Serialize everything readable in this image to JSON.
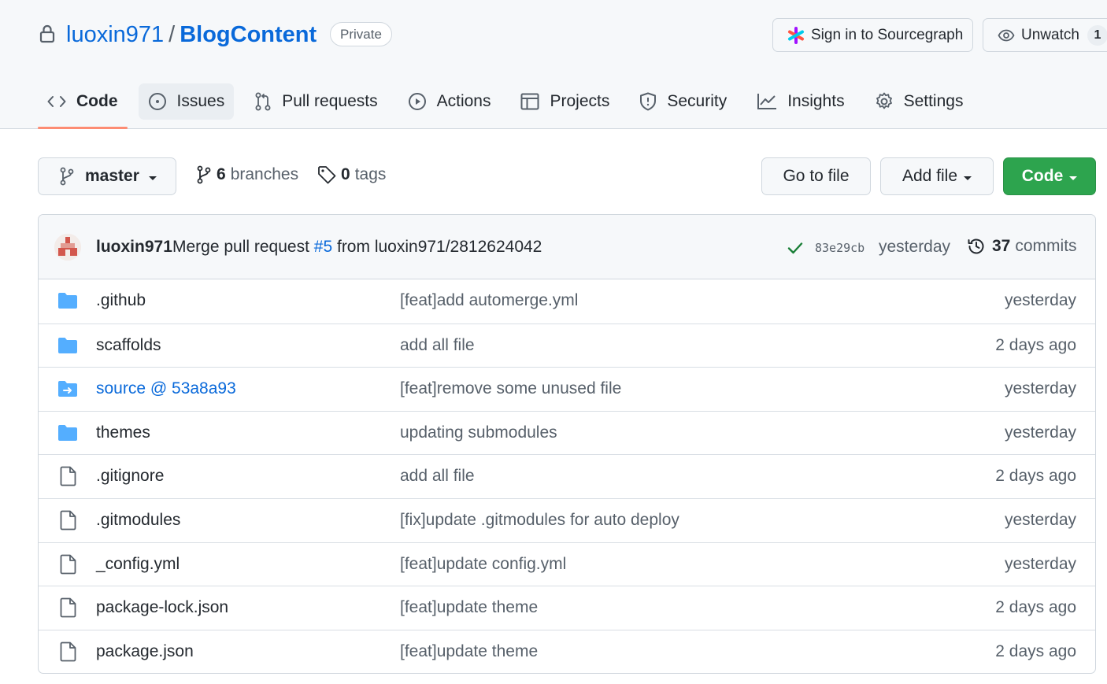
{
  "repo": {
    "owner": "luoxin971",
    "separator": "/",
    "name": "BlogContent",
    "visibility": "Private"
  },
  "header_actions": {
    "sourcegraph_label": "Sign in to Sourcegraph",
    "watch_label": "Unwatch",
    "watch_count": "1"
  },
  "tabs": [
    {
      "label": "Code",
      "icon": "code-icon",
      "active": true
    },
    {
      "label": "Issues",
      "icon": "issue-opened-icon"
    },
    {
      "label": "Pull requests",
      "icon": "git-pull-request-icon"
    },
    {
      "label": "Actions",
      "icon": "play-icon"
    },
    {
      "label": "Projects",
      "icon": "table-icon"
    },
    {
      "label": "Security",
      "icon": "shield-icon"
    },
    {
      "label": "Insights",
      "icon": "graph-icon"
    },
    {
      "label": "Settings",
      "icon": "gear-icon"
    }
  ],
  "toolbar": {
    "branch": "master",
    "branches_count": "6",
    "branches_label": "branches",
    "tags_count": "0",
    "tags_label": "tags",
    "go_to_file": "Go to file",
    "add_file": "Add file",
    "code": "Code"
  },
  "latest_commit": {
    "author": "luoxin971",
    "message_prefix": "Merge pull request",
    "pr_ref": "#5",
    "message_suffix": "from luoxin971/2812624042",
    "sha": "83e29cb",
    "time": "yesterday",
    "commits_count": "37",
    "commits_label": "commits",
    "status_color": "#1a7f37"
  },
  "files": [
    {
      "name": ".github",
      "type": "folder",
      "message": "[feat]add automerge.yml",
      "time": "yesterday"
    },
    {
      "name": "scaffolds",
      "type": "folder",
      "message": "add all file",
      "time": "2 days ago"
    },
    {
      "name": "source @ 53a8a93",
      "type": "submodule",
      "message": "[feat]remove some unused file",
      "time": "yesterday"
    },
    {
      "name": "themes",
      "type": "folder",
      "message": "updating submodules",
      "time": "yesterday"
    },
    {
      "name": ".gitignore",
      "type": "file",
      "message": "add all file",
      "time": "2 days ago"
    },
    {
      "name": ".gitmodules",
      "type": "file",
      "message": "[fix]update .gitmodules for auto deploy",
      "time": "yesterday"
    },
    {
      "name": "_config.yml",
      "type": "file",
      "message": "[feat]update config.yml",
      "time": "yesterday"
    },
    {
      "name": "package-lock.json",
      "type": "file",
      "message": "[feat]update theme",
      "time": "2 days ago"
    },
    {
      "name": "package.json",
      "type": "file",
      "message": "[feat]update theme",
      "time": "2 days ago"
    }
  ],
  "colors": {
    "link": "#0969da",
    "folder": "#54aeff",
    "primary_button": "#2da44e",
    "active_tab_underline": "#fd8c73"
  }
}
